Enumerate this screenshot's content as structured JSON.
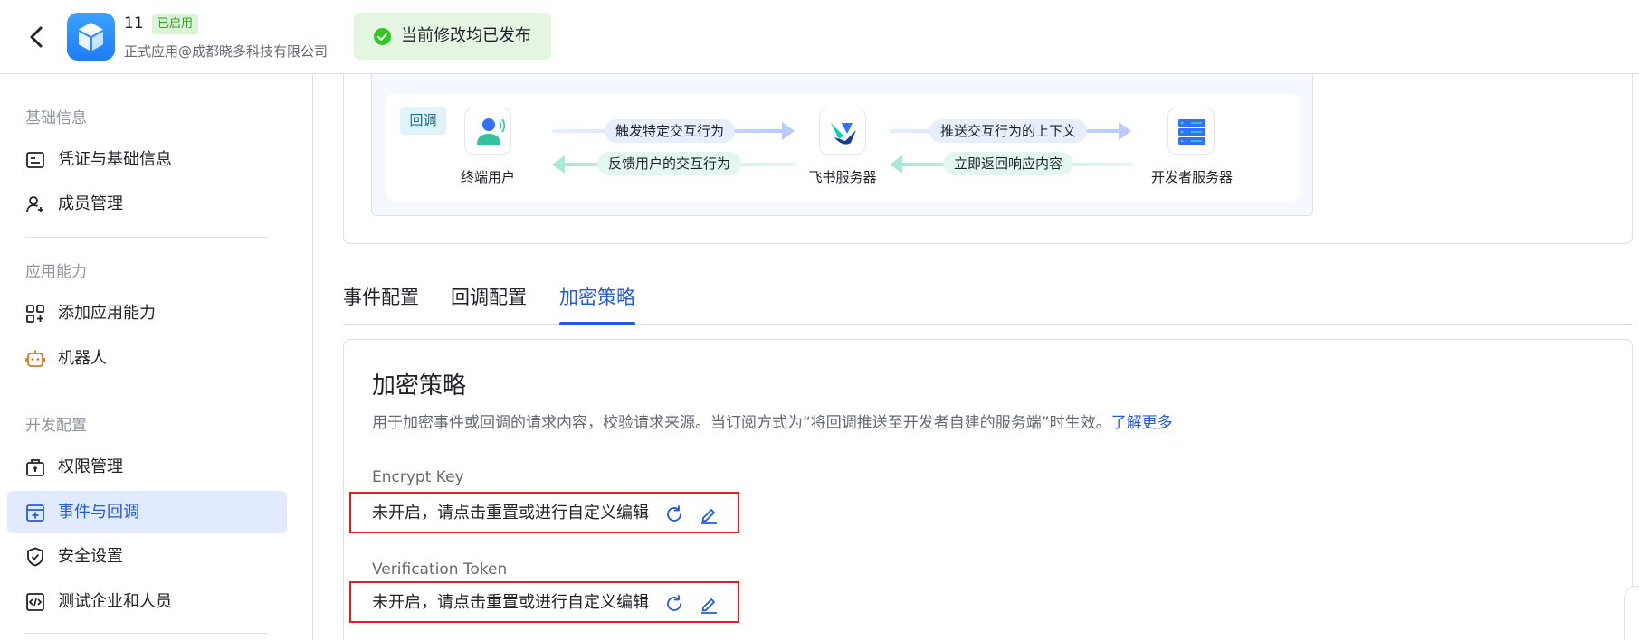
{
  "header": {
    "app_name": "11",
    "status": "已启用",
    "org": "正式应用@成都晓多科技有限公司",
    "publish_notice": "当前修改均已发布"
  },
  "sidebar": {
    "groups": [
      {
        "title": "基础信息",
        "items": [
          {
            "label": "凭证与基础信息",
            "icon": "id-card-icon"
          },
          {
            "label": "成员管理",
            "icon": "user-add-icon"
          }
        ]
      },
      {
        "title": "应用能力",
        "items": [
          {
            "label": "添加应用能力",
            "icon": "app-grid-add-icon"
          },
          {
            "label": "机器人",
            "icon": "robot-icon"
          }
        ]
      },
      {
        "title": "开发配置",
        "items": [
          {
            "label": "权限管理",
            "icon": "briefcase-lock-icon"
          },
          {
            "label": "事件与回调",
            "icon": "event-callback-icon",
            "active": true
          },
          {
            "label": "安全设置",
            "icon": "shield-check-icon"
          },
          {
            "label": "测试企业和人员",
            "icon": "code-box-icon"
          }
        ]
      }
    ]
  },
  "flow": {
    "tag": "回调",
    "nodes": [
      "终端用户",
      "飞书服务器",
      "开发者服务器"
    ],
    "arrows": {
      "user_to_server": "触发特定交互行为",
      "server_to_user": "反馈用户的交互行为",
      "server_to_dev": "推送交互行为的上下文",
      "dev_to_server": "立即返回响应内容"
    }
  },
  "tabs": [
    "事件配置",
    "回调配置",
    "加密策略"
  ],
  "active_tab": "加密策略",
  "encrypt": {
    "title": "加密策略",
    "description": "用于加密事件或回调的请求内容，校验请求来源。当订阅方式为“将回调推送至开发者自建的服务端”时生效。",
    "learn_more": "了解更多",
    "fields": [
      {
        "label": "Encrypt Key",
        "value": "未开启，请点击重置或进行自定义编辑"
      },
      {
        "label": "Verification Token",
        "value": "未开启，请点击重置或进行自定义编辑"
      }
    ]
  },
  "colors": {
    "accent": "#245bdb",
    "highlight_border": "#e0201f",
    "success": "#34c724"
  }
}
